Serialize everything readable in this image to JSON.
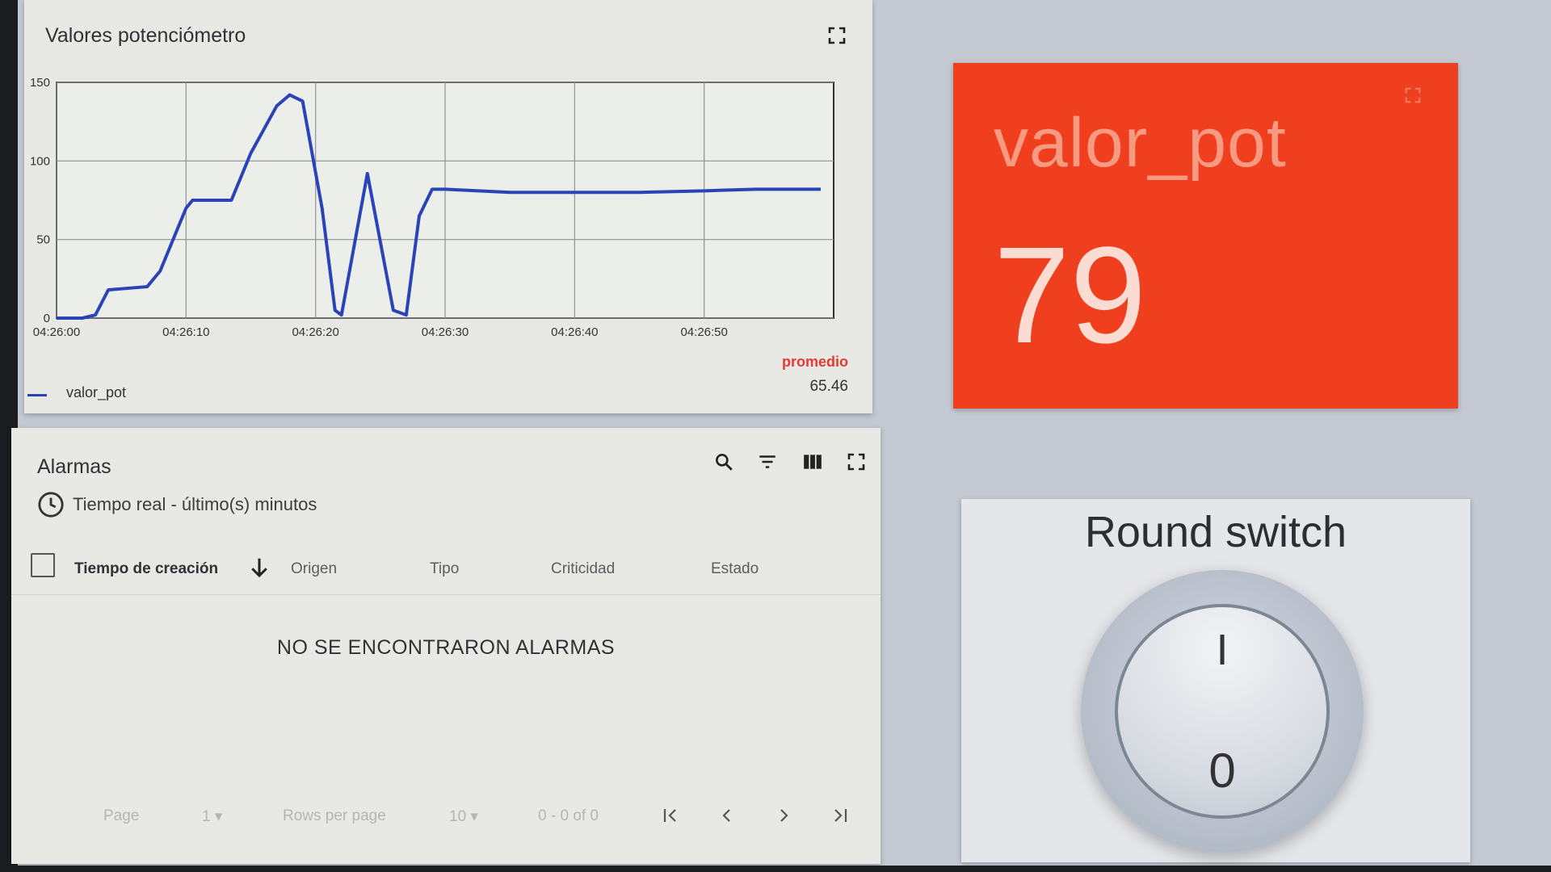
{
  "chart_widget": {
    "title": "Valores potenciómetro",
    "fullscreen_icon": "fullscreen-icon",
    "legend": {
      "series_name": "valor_pot",
      "color": "#2a44b8"
    },
    "stats": {
      "label": "promedio",
      "value": "65.46",
      "label_color": "#e53935"
    }
  },
  "chart_data": {
    "type": "line",
    "title": "Valores potenciómetro",
    "xlabel": "",
    "ylabel": "",
    "x_tick_labels": [
      "04:26:00",
      "04:26:10",
      "04:26:20",
      "04:26:30",
      "04:26:40",
      "04:26:50"
    ],
    "y_tick_labels": [
      "0",
      "50",
      "100",
      "150"
    ],
    "ylim": [
      0,
      150
    ],
    "xlim_seconds": [
      0,
      60
    ],
    "grid": true,
    "legend_position": "bottom-left",
    "series": [
      {
        "name": "valor_pot",
        "color": "#2a44b8",
        "x_seconds": [
          0,
          2,
          3,
          4,
          7,
          8,
          9,
          10,
          10.5,
          12,
          13.5,
          15,
          17,
          18,
          19,
          20.5,
          21.5,
          22,
          24,
          26,
          27,
          28,
          29,
          30,
          35,
          40,
          45,
          50,
          54,
          59
        ],
        "values": [
          0,
          0,
          2,
          18,
          20,
          30,
          50,
          70,
          75,
          75,
          75,
          105,
          135,
          142,
          138,
          70,
          5,
          2,
          92,
          5,
          2,
          65,
          82,
          82,
          80,
          80,
          80,
          81,
          82,
          82
        ]
      }
    ]
  },
  "alarms_widget": {
    "title": "Alarmas",
    "subtitle": "Tiempo real - último(s) minutos",
    "columns": [
      "Tiempo de creación",
      "Origen",
      "Tipo",
      "Criticidad",
      "Estado"
    ],
    "empty_message": "NO SE ENCONTRARON ALARMAS",
    "pagination": {
      "page_label": "Page",
      "page_value": "1",
      "rows_label": "Rows per page",
      "rows_value": "10",
      "range": "0 - 0 of 0"
    }
  },
  "value_widget": {
    "label": "valor_pot",
    "value": "79",
    "bg_color": "#ef3f1e"
  },
  "switch_widget": {
    "title": "Round switch",
    "on_label": "I",
    "off_label": "0"
  }
}
